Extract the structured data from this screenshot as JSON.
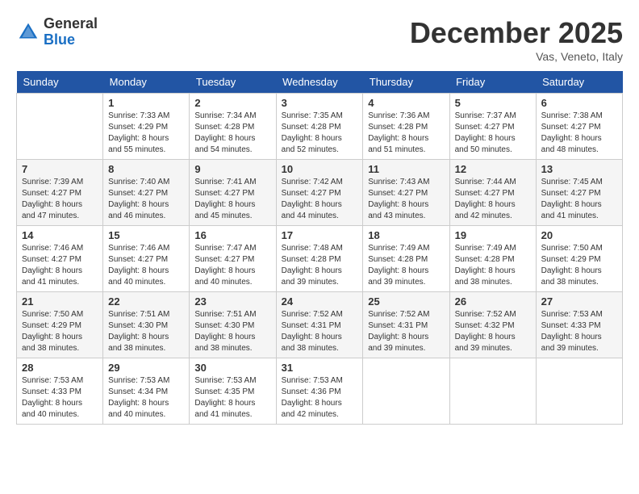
{
  "header": {
    "logo_general": "General",
    "logo_blue": "Blue",
    "month_title": "December 2025",
    "location": "Vas, Veneto, Italy"
  },
  "days_of_week": [
    "Sunday",
    "Monday",
    "Tuesday",
    "Wednesday",
    "Thursday",
    "Friday",
    "Saturday"
  ],
  "weeks": [
    [
      {
        "day": "",
        "info": ""
      },
      {
        "day": "1",
        "info": "Sunrise: 7:33 AM\nSunset: 4:29 PM\nDaylight: 8 hours\nand 55 minutes."
      },
      {
        "day": "2",
        "info": "Sunrise: 7:34 AM\nSunset: 4:28 PM\nDaylight: 8 hours\nand 54 minutes."
      },
      {
        "day": "3",
        "info": "Sunrise: 7:35 AM\nSunset: 4:28 PM\nDaylight: 8 hours\nand 52 minutes."
      },
      {
        "day": "4",
        "info": "Sunrise: 7:36 AM\nSunset: 4:28 PM\nDaylight: 8 hours\nand 51 minutes."
      },
      {
        "day": "5",
        "info": "Sunrise: 7:37 AM\nSunset: 4:27 PM\nDaylight: 8 hours\nand 50 minutes."
      },
      {
        "day": "6",
        "info": "Sunrise: 7:38 AM\nSunset: 4:27 PM\nDaylight: 8 hours\nand 48 minutes."
      }
    ],
    [
      {
        "day": "7",
        "info": "Sunrise: 7:39 AM\nSunset: 4:27 PM\nDaylight: 8 hours\nand 47 minutes."
      },
      {
        "day": "8",
        "info": "Sunrise: 7:40 AM\nSunset: 4:27 PM\nDaylight: 8 hours\nand 46 minutes."
      },
      {
        "day": "9",
        "info": "Sunrise: 7:41 AM\nSunset: 4:27 PM\nDaylight: 8 hours\nand 45 minutes."
      },
      {
        "day": "10",
        "info": "Sunrise: 7:42 AM\nSunset: 4:27 PM\nDaylight: 8 hours\nand 44 minutes."
      },
      {
        "day": "11",
        "info": "Sunrise: 7:43 AM\nSunset: 4:27 PM\nDaylight: 8 hours\nand 43 minutes."
      },
      {
        "day": "12",
        "info": "Sunrise: 7:44 AM\nSunset: 4:27 PM\nDaylight: 8 hours\nand 42 minutes."
      },
      {
        "day": "13",
        "info": "Sunrise: 7:45 AM\nSunset: 4:27 PM\nDaylight: 8 hours\nand 41 minutes."
      }
    ],
    [
      {
        "day": "14",
        "info": "Sunrise: 7:46 AM\nSunset: 4:27 PM\nDaylight: 8 hours\nand 41 minutes."
      },
      {
        "day": "15",
        "info": "Sunrise: 7:46 AM\nSunset: 4:27 PM\nDaylight: 8 hours\nand 40 minutes."
      },
      {
        "day": "16",
        "info": "Sunrise: 7:47 AM\nSunset: 4:27 PM\nDaylight: 8 hours\nand 40 minutes."
      },
      {
        "day": "17",
        "info": "Sunrise: 7:48 AM\nSunset: 4:28 PM\nDaylight: 8 hours\nand 39 minutes."
      },
      {
        "day": "18",
        "info": "Sunrise: 7:49 AM\nSunset: 4:28 PM\nDaylight: 8 hours\nand 39 minutes."
      },
      {
        "day": "19",
        "info": "Sunrise: 7:49 AM\nSunset: 4:28 PM\nDaylight: 8 hours\nand 38 minutes."
      },
      {
        "day": "20",
        "info": "Sunrise: 7:50 AM\nSunset: 4:29 PM\nDaylight: 8 hours\nand 38 minutes."
      }
    ],
    [
      {
        "day": "21",
        "info": "Sunrise: 7:50 AM\nSunset: 4:29 PM\nDaylight: 8 hours\nand 38 minutes."
      },
      {
        "day": "22",
        "info": "Sunrise: 7:51 AM\nSunset: 4:30 PM\nDaylight: 8 hours\nand 38 minutes."
      },
      {
        "day": "23",
        "info": "Sunrise: 7:51 AM\nSunset: 4:30 PM\nDaylight: 8 hours\nand 38 minutes."
      },
      {
        "day": "24",
        "info": "Sunrise: 7:52 AM\nSunset: 4:31 PM\nDaylight: 8 hours\nand 38 minutes."
      },
      {
        "day": "25",
        "info": "Sunrise: 7:52 AM\nSunset: 4:31 PM\nDaylight: 8 hours\nand 39 minutes."
      },
      {
        "day": "26",
        "info": "Sunrise: 7:52 AM\nSunset: 4:32 PM\nDaylight: 8 hours\nand 39 minutes."
      },
      {
        "day": "27",
        "info": "Sunrise: 7:53 AM\nSunset: 4:33 PM\nDaylight: 8 hours\nand 39 minutes."
      }
    ],
    [
      {
        "day": "28",
        "info": "Sunrise: 7:53 AM\nSunset: 4:33 PM\nDaylight: 8 hours\nand 40 minutes."
      },
      {
        "day": "29",
        "info": "Sunrise: 7:53 AM\nSunset: 4:34 PM\nDaylight: 8 hours\nand 40 minutes."
      },
      {
        "day": "30",
        "info": "Sunrise: 7:53 AM\nSunset: 4:35 PM\nDaylight: 8 hours\nand 41 minutes."
      },
      {
        "day": "31",
        "info": "Sunrise: 7:53 AM\nSunset: 4:36 PM\nDaylight: 8 hours\nand 42 minutes."
      },
      {
        "day": "",
        "info": ""
      },
      {
        "day": "",
        "info": ""
      },
      {
        "day": "",
        "info": ""
      }
    ]
  ]
}
